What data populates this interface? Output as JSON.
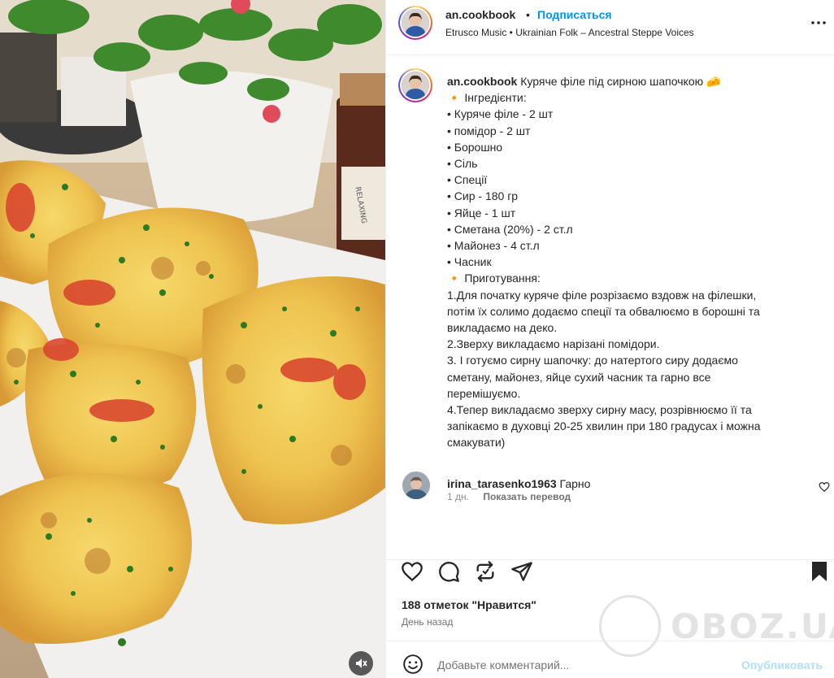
{
  "post": {
    "username": "an.cookbook",
    "separator": "•",
    "follow_label": "Подписаться",
    "audio": "Etrusco Music • Ukrainian Folk – Ancestral Steppe Voices",
    "more_icon": "more-horizontal-icon"
  },
  "caption": {
    "username": "an.cookbook",
    "title": "Куряче філе під сирною шапочкою 🧀",
    "lines": [
      "",
      "🔸 Інгредієнти:",
      "• Куряче філе - 2 шт",
      "• помідор - 2 шт",
      "• Борошно",
      "• Сіль",
      "• Спеції",
      "• Сир - 180 гр",
      "• Яйце - 1 шт",
      "• Сметана (20%) - 2 ст.л",
      "• Майонез - 4 ст.л",
      "• Часник",
      "",
      "🔸 Приготування:",
      "1.Для початку куряче філе розрізаємо вздовж на філешки,",
      "потім їх солимо додаємо спеції та обвалюємо в борошні та",
      "викладаємо на деко.",
      "2.Зверху викладаємо нарізані помідори.",
      "3. І готуємо сирну шапочку: до натертого сиру додаємо",
      "сметану, майонез, яйце сухий часник та гарно все",
      "перемішуємо.",
      "4.Тепер викладаємо зверху сирну масу, розрівнюємо її та",
      "запікаємо в духовці 20-25 хвилин при 180 градусах і можна",
      "смакувати)"
    ],
    "age": "1 дн.",
    "translate_label": "Показать перевод"
  },
  "comment": {
    "username": "irina_tarasenko1963",
    "text": "Гарно"
  },
  "actions": {
    "likes": "188 отметок \"Нравится\"",
    "date": "День назад"
  },
  "add_comment": {
    "placeholder": "Добавьте комментарий...",
    "publish_label": "Опубликовать"
  },
  "media": {
    "jar_label": "RELAXING"
  },
  "watermark": {
    "text": "OBOZ.UA"
  },
  "colors": {
    "accent_blue": "#0095f6",
    "publish_disabled": "#b2dffc",
    "secondary_text": "#737373",
    "border": "#efefef"
  }
}
